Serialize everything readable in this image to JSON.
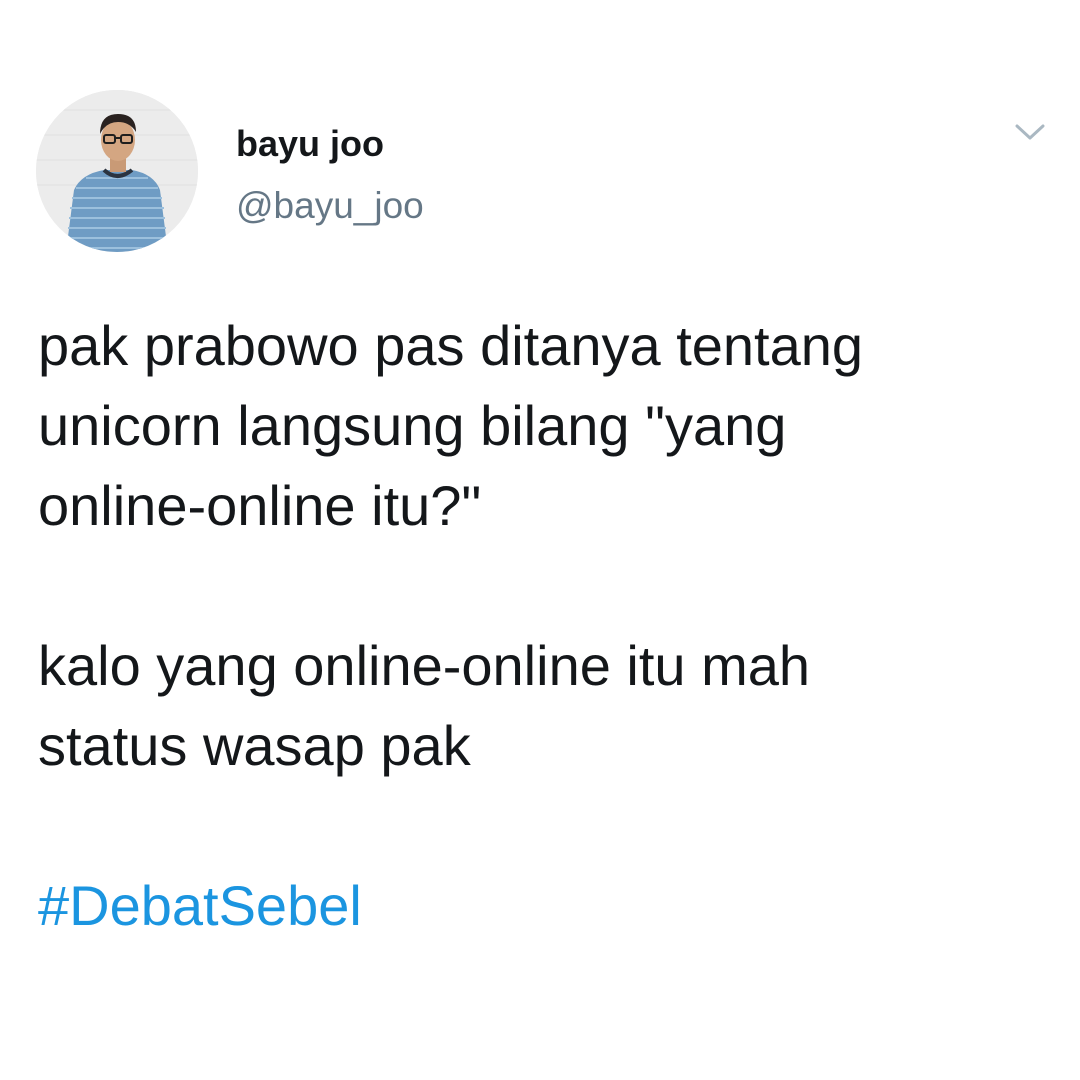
{
  "tweet": {
    "author": {
      "display_name": "bayu joo",
      "handle": "@bayu_joo",
      "avatar_icon": "profile-photo"
    },
    "menu_icon": "chevron-down-icon",
    "text_lines": {
      "line1": "pak prabowo pas ditanya tentang",
      "line2": "unicorn langsung bilang \"yang",
      "line3": "online-online itu?\"",
      "line4": "kalo yang online-online itu mah",
      "line5": "status wasap pak"
    },
    "hashtag": "#DebatSebel"
  },
  "colors": {
    "text": "#14171a",
    "secondary_text": "#657786",
    "link": "#1b95e0",
    "chevron": "#aab8c2",
    "background": "#ffffff"
  }
}
